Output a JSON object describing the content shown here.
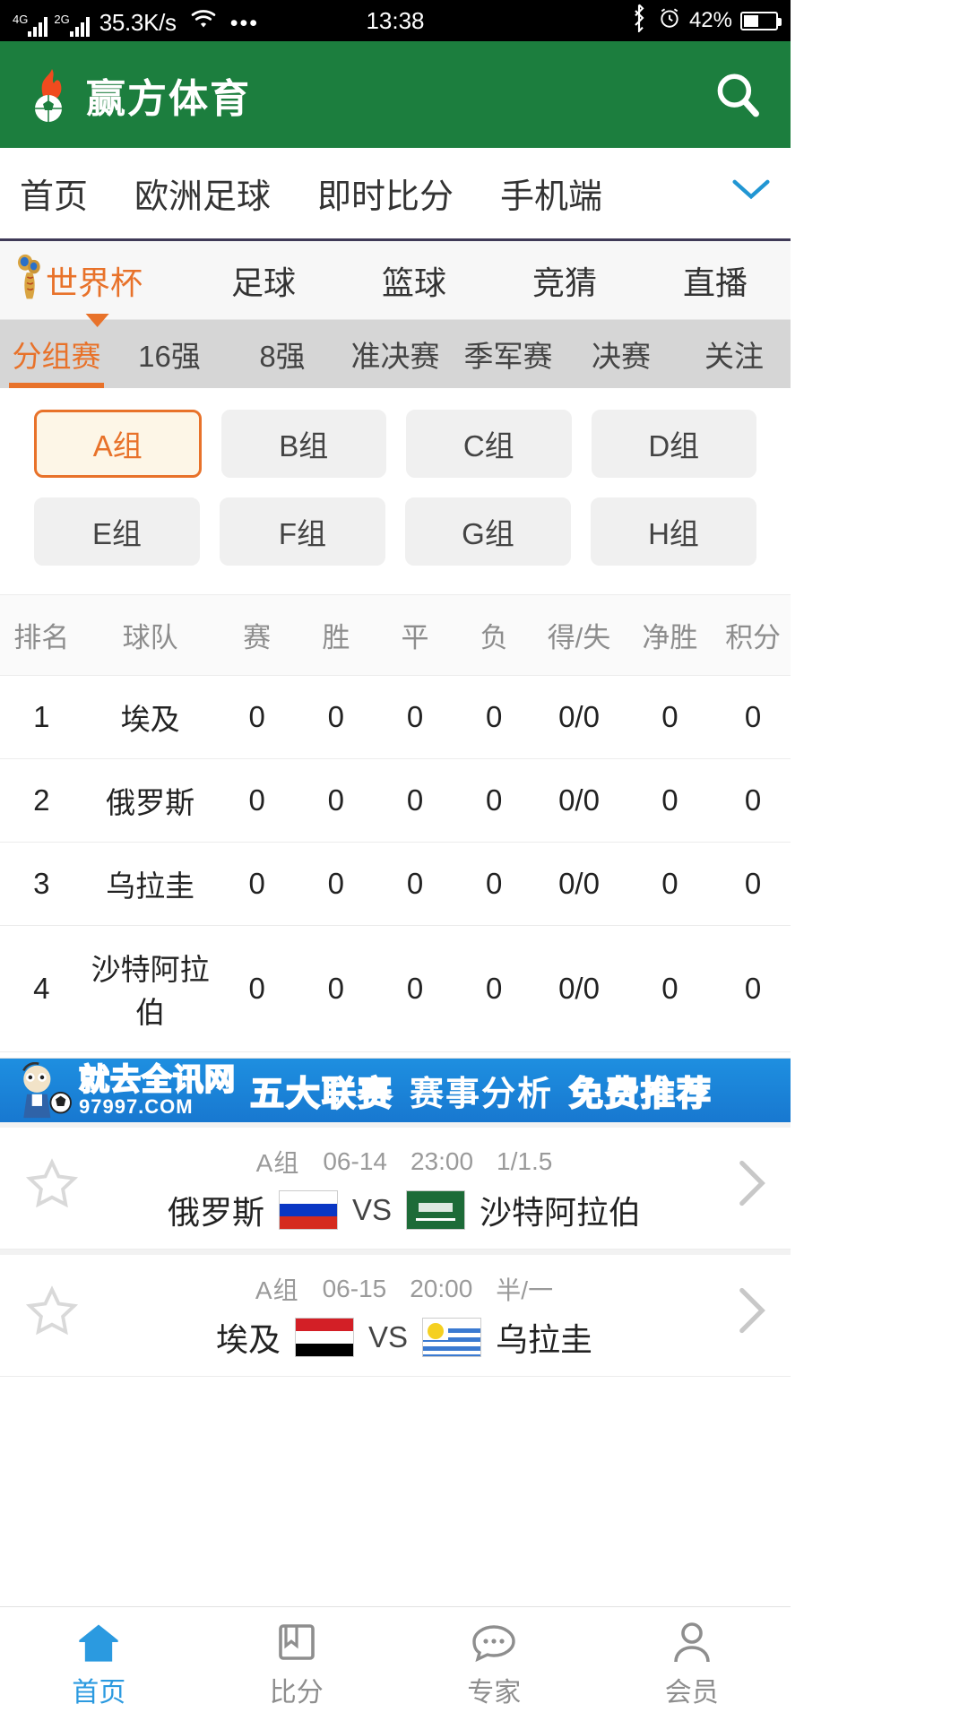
{
  "status_bar": {
    "network_4g": "4G",
    "network_2g": "2G",
    "speed": "35.3K/s",
    "wifi_icon": "wifi-icon",
    "more_dots": "•••",
    "time": "13:38",
    "bluetooth_icon": "bluetooth-icon",
    "alarm_icon": "alarm-icon",
    "battery_percent": "42%"
  },
  "header": {
    "logo_icon": "flaming-soccer-ball-icon",
    "title": "赢方体育",
    "search_icon": "search-icon",
    "background_color": "#1c7e3e"
  },
  "nav": {
    "items": [
      {
        "label": "首页"
      },
      {
        "label": "欧洲足球"
      },
      {
        "label": "即时比分"
      },
      {
        "label": "手机端"
      }
    ],
    "expand_icon": "chevron-down-icon",
    "expand_color": "#2196d3"
  },
  "sport_tabs": {
    "accent_color": "#e8722a",
    "items": [
      {
        "label": "世界杯",
        "active": true,
        "icon": "world-cup-trophy-icon"
      },
      {
        "label": "足球",
        "active": false
      },
      {
        "label": "篮球",
        "active": false
      },
      {
        "label": "竞猜",
        "active": false
      },
      {
        "label": "直播",
        "active": false
      }
    ]
  },
  "stage_tabs": {
    "items": [
      {
        "label": "分组赛",
        "active": true
      },
      {
        "label": "16强",
        "active": false
      },
      {
        "label": "8强",
        "active": false
      },
      {
        "label": "准决赛",
        "active": false
      },
      {
        "label": "季军赛",
        "active": false
      },
      {
        "label": "决赛",
        "active": false
      },
      {
        "label": "关注",
        "active": false
      }
    ]
  },
  "group_chips": {
    "row1": [
      {
        "label": "A组",
        "selected": true
      },
      {
        "label": "B组",
        "selected": false
      },
      {
        "label": "C组",
        "selected": false
      },
      {
        "label": "D组",
        "selected": false
      }
    ],
    "row2": [
      {
        "label": "E组",
        "selected": false
      },
      {
        "label": "F组",
        "selected": false
      },
      {
        "label": "G组",
        "selected": false
      },
      {
        "label": "H组",
        "selected": false
      }
    ]
  },
  "standings": {
    "headers": [
      "排名",
      "球队",
      "赛",
      "胜",
      "平",
      "负",
      "得/失",
      "净胜",
      "积分"
    ],
    "rows": [
      {
        "rank": "1",
        "team": "埃及",
        "played": "0",
        "win": "0",
        "draw": "0",
        "loss": "0",
        "gf_ga": "0/0",
        "gd": "0",
        "points": "0"
      },
      {
        "rank": "2",
        "team": "俄罗斯",
        "played": "0",
        "win": "0",
        "draw": "0",
        "loss": "0",
        "gf_ga": "0/0",
        "gd": "0",
        "points": "0"
      },
      {
        "rank": "3",
        "team": "乌拉圭",
        "played": "0",
        "win": "0",
        "draw": "0",
        "loss": "0",
        "gf_ga": "0/0",
        "gd": "0",
        "points": "0"
      },
      {
        "rank": "4",
        "team": "沙特阿拉伯",
        "played": "0",
        "win": "0",
        "draw": "0",
        "loss": "0",
        "gf_ga": "0/0",
        "gd": "0",
        "points": "0"
      }
    ]
  },
  "ad_banner": {
    "mascot_icon": "cartoon-mascot-icon",
    "brand_cn": "就去全讯网",
    "brand_url": "97997.COM",
    "text1": "五大联赛",
    "text2": "赛事分析",
    "text3": "免费推荐",
    "background_color": "#1e8fe0"
  },
  "matches": [
    {
      "star_icon": "star-outline-icon",
      "group": "A组",
      "date": "06-14",
      "time": "23:00",
      "odds": "1/1.5",
      "home_team": "俄罗斯",
      "home_flag": "russia-flag",
      "vs": "VS",
      "away_team": "沙特阿拉伯",
      "away_flag": "saudi-arabia-flag",
      "chevron_icon": "chevron-right-icon"
    },
    {
      "star_icon": "star-outline-icon",
      "group": "A组",
      "date": "06-15",
      "time": "20:00",
      "odds": "半/一",
      "home_team": "埃及",
      "home_flag": "egypt-flag",
      "vs": "VS",
      "away_team": "乌拉圭",
      "away_flag": "uruguay-flag",
      "chevron_icon": "chevron-right-icon"
    }
  ],
  "tabbar": {
    "active_color": "#2b9ae0",
    "items": [
      {
        "label": "首页",
        "icon": "home-icon",
        "active": true
      },
      {
        "label": "比分",
        "icon": "scoreboard-icon",
        "active": false
      },
      {
        "label": "专家",
        "icon": "expert-chat-icon",
        "active": false
      },
      {
        "label": "会员",
        "icon": "member-person-icon",
        "active": false
      }
    ]
  }
}
